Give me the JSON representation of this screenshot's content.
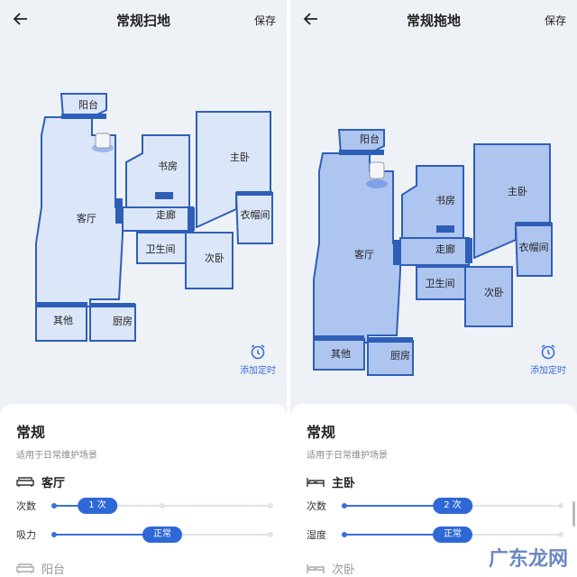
{
  "colors": {
    "accent": "#2e68d6",
    "room_left": "#dbe6f8",
    "room_right": "#aec5ef",
    "wall": "#2e5fb8"
  },
  "left": {
    "title": "常规扫地",
    "save": "保存",
    "rooms": [
      "阳台",
      "书房",
      "主卧",
      "客厅",
      "走廊",
      "衣帽间",
      "卫生间",
      "次卧",
      "其他",
      "厨房"
    ],
    "timer_label": "添加定时",
    "mode_title": "常规",
    "mode_subtitle": "适用于日常维护场景",
    "room1": "客厅",
    "setting1_label": "次数",
    "setting1_value": "1 次",
    "setting1_level": 0.2,
    "setting2_label": "吸力",
    "setting2_value": "正常",
    "setting2_level": 0.5,
    "room2": "阳台"
  },
  "right": {
    "title": "常规拖地",
    "save": "保存",
    "rooms": [
      "阳台",
      "书房",
      "主卧",
      "客厅",
      "走廊",
      "衣帽间",
      "卫生间",
      "次卧",
      "其他",
      "厨房"
    ],
    "timer_label": "添加定时",
    "mode_title": "常规",
    "mode_subtitle": "适用于日常维护场景",
    "room1": "主卧",
    "setting1_label": "次数",
    "setting1_value": "2 次",
    "setting1_level": 0.5,
    "setting2_label": "湿度",
    "setting2_value": "正常",
    "setting2_level": 0.5,
    "room2": "次卧"
  },
  "watermark": "广东龙网"
}
